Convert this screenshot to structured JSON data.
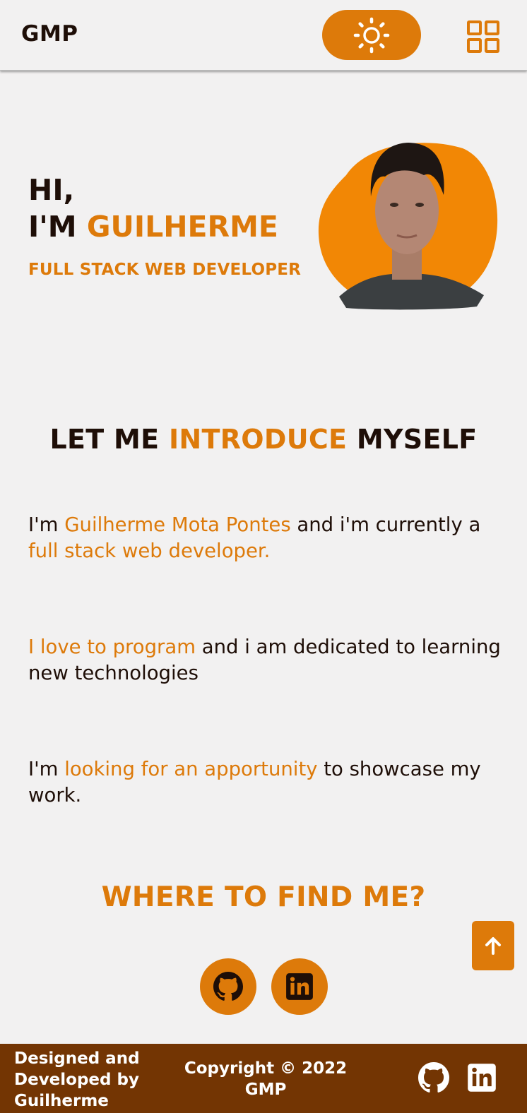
{
  "header": {
    "logo": "GMP",
    "theme_toggle_icon": "sun-icon",
    "menu_icon": "grid-menu-icon"
  },
  "hero": {
    "line1": "HI,",
    "line2_prefix": "I'M ",
    "line2_name": "GUILHERME",
    "subtitle": "FULL STACK WEB DEVELOPER"
  },
  "intro": {
    "title_part1": "LET ME ",
    "title_part2": "INTRODUCE",
    "title_part3": " MYSELF",
    "p1": {
      "a": "I'm ",
      "b": "Guilherme Mota Pontes",
      "c": " and i'm currently a ",
      "d": "full stack web developer."
    },
    "p2": {
      "a": "I love to program",
      "b": " and i am dedicated to learning new technologies"
    },
    "p3": {
      "a": "I'm ",
      "b": "looking for an apportunity",
      "c": " to showcase my work."
    }
  },
  "find_me": {
    "title": "WHERE TO FIND ME?",
    "links": [
      {
        "icon": "github-icon"
      },
      {
        "icon": "linkedin-icon"
      }
    ]
  },
  "scroll_top_icon": "arrow-up-icon",
  "footer": {
    "designed": "Designed and Developed by Guilherme Pontes",
    "copyright": "Copyright © 2022 GMP"
  },
  "colors": {
    "accent": "#dd7a0a",
    "background": "#f2f1f1",
    "text": "#1e0e07",
    "footer_bg": "#733503"
  }
}
